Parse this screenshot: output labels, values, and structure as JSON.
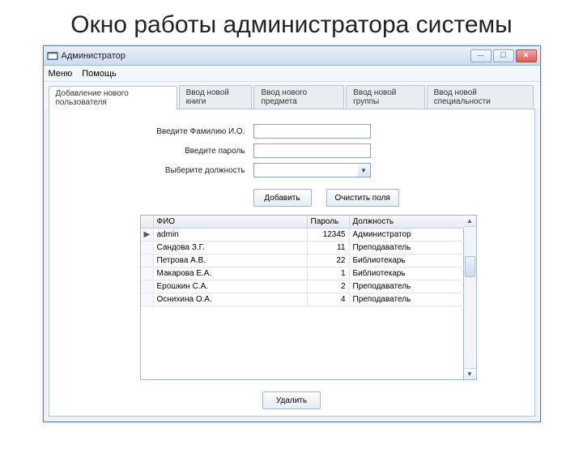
{
  "slide": {
    "title": "Окно работы администратора системы"
  },
  "window": {
    "title": "Администратор"
  },
  "menu": {
    "menu": "Меню",
    "help": "Помощь"
  },
  "tabs": [
    {
      "label": "Добавление нового пользователя"
    },
    {
      "label": "Ввод новой книги"
    },
    {
      "label": "Ввод нового предмета"
    },
    {
      "label": "Ввод новой группы"
    },
    {
      "label": "Ввод новой специальности"
    }
  ],
  "form": {
    "fio_label": "Введите Фамилию И.О.",
    "password_label": "Введите пароль",
    "role_label": "Выберите должность",
    "fio_value": "",
    "password_value": "",
    "role_value": ""
  },
  "buttons": {
    "add": "Добавить",
    "clear": "Очистить поля",
    "delete": "Удалить"
  },
  "grid": {
    "headers": {
      "fio": "ФИО",
      "password": "Пароль",
      "role": "Должность"
    },
    "rows": [
      {
        "marker": "▶",
        "fio": "admin",
        "password": "12345",
        "role": "Администратор"
      },
      {
        "marker": "",
        "fio": "Сандова З.Г.",
        "password": "11",
        "role": "Преподаватель"
      },
      {
        "marker": "",
        "fio": "Петрова А.В.",
        "password": "22",
        "role": "Библиотекарь"
      },
      {
        "marker": "",
        "fio": "Макарова Е.А.",
        "password": "1",
        "role": "Библиотекарь"
      },
      {
        "marker": "",
        "fio": "Ерошкин С.А.",
        "password": "2",
        "role": "Преподаватель"
      },
      {
        "marker": "",
        "fio": "Оснихина О.А.",
        "password": "4",
        "role": "Преподаватель"
      }
    ]
  }
}
